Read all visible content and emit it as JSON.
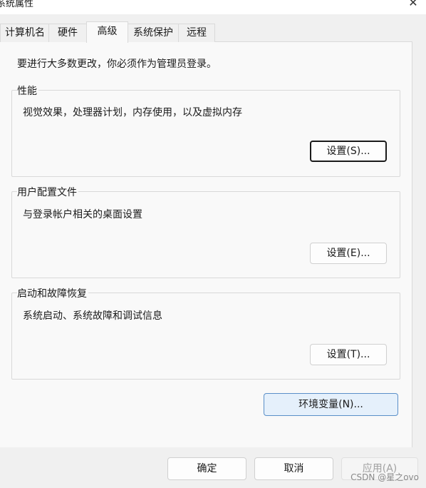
{
  "window": {
    "title": "系统属性",
    "close_glyph": "✕"
  },
  "tabs": [
    {
      "label": "计算机名",
      "active": false
    },
    {
      "label": "硬件",
      "active": false
    },
    {
      "label": "高级",
      "active": true
    },
    {
      "label": "系统保护",
      "active": false
    },
    {
      "label": "远程",
      "active": false
    }
  ],
  "advanced": {
    "admin_note": "要进行大多数更改，你必须作为管理员登录。",
    "performance": {
      "title": "性能",
      "description": "视觉效果，处理器计划，内存使用，以及虚拟内存",
      "button": "设置(S)..."
    },
    "user_profiles": {
      "title": "用户配置文件",
      "description": "与登录帐户相关的桌面设置",
      "button": "设置(E)..."
    },
    "startup_recovery": {
      "title": "启动和故障恢复",
      "description": "系统启动、系统故障和调试信息",
      "button": "设置(T)..."
    },
    "env_button": "环境变量(N)..."
  },
  "footer": {
    "ok": "确定",
    "cancel": "取消",
    "apply": "应用(A)"
  },
  "watermark": "CSDN @星之ovo",
  "colors": {
    "panel_bg": "#f9f9f9",
    "window_bg": "#f0f0f0",
    "accent_border": "#5a8fc8",
    "accent_fill": "#e5f0fb"
  }
}
